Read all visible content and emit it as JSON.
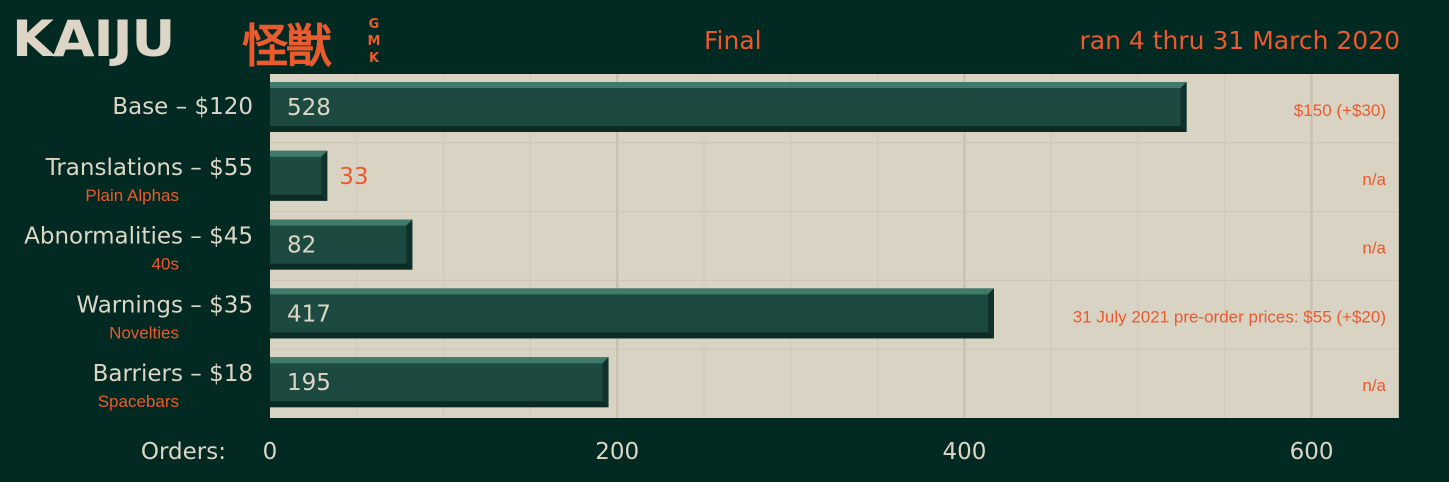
{
  "header": {
    "logo_word": "KAIJU",
    "logo_kanji": "怪獣",
    "logo_gmk": [
      "G",
      "M",
      "K"
    ],
    "status": "Final",
    "dates": "ran 4 thru 31 March 2020"
  },
  "colors": {
    "background": "#022a23",
    "plot": "#d9d3c4",
    "bar": "#1c4a40",
    "accent": "#ea5a2d",
    "text": "#ddd6c6"
  },
  "chart_data": {
    "type": "bar",
    "orientation": "horizontal",
    "xlabel": "Orders:",
    "xlim": [
      0,
      650
    ],
    "xticks": [
      0,
      200,
      400,
      600
    ],
    "grid": true,
    "categories": [
      "Base – $120",
      "Translations – $55",
      "Abnormalities – $45",
      "Warnings – $35",
      "Barriers – $18"
    ],
    "subtitles": [
      "",
      "Plain Alphas",
      "40s",
      "Novelties",
      "Spacebars"
    ],
    "values": [
      528,
      33,
      82,
      417,
      195
    ],
    "annotations": [
      "$150  (+$30)",
      "n/a",
      "n/a",
      "31 July 2021  pre-order prices:     $55  (+$20)",
      "n/a"
    ]
  }
}
